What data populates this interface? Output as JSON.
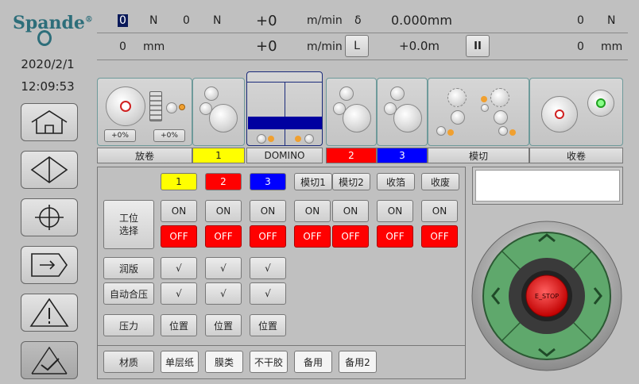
{
  "logo": {
    "text": "Spande",
    "mark": "®"
  },
  "date": "2020/2/1",
  "time": "12:09:53",
  "status": {
    "row1": {
      "v1": "0",
      "n1": "N",
      "v2": "0",
      "n2": "N",
      "plus1": "+0",
      "unit1": "m/min",
      "delta_symbol": "δ",
      "delta_value": "0.000mm",
      "v3": "0",
      "n3": "N"
    },
    "row2": {
      "v1": "0",
      "u1": "mm",
      "plus2": "+0",
      "unit2": "m/min",
      "l_button": "L",
      "offset": "+0.0m",
      "pause_button": "II",
      "v3": "0",
      "u3": "mm"
    }
  },
  "stations": {
    "unwind_pct_a": "+0%",
    "unwind_pct_b": "+0%",
    "labels": [
      "放卷",
      "1",
      "DOMINO",
      "2",
      "3",
      "模切",
      "收卷"
    ]
  },
  "control": {
    "columns": [
      "1",
      "2",
      "3",
      "模切1",
      "模切2",
      "收箔",
      "收废"
    ],
    "row_station_label": "工位\n选择",
    "on_label": "ON",
    "off_label": "OFF",
    "row_run_label": "润版",
    "row_auto_label": "自动合压",
    "check": "√",
    "row_pressure_label": "压力",
    "position_label": "位置",
    "row_material_label": "材质",
    "materials": [
      "单层纸",
      "膜类",
      "不干胶",
      "备用",
      "备用2"
    ]
  },
  "estop": {
    "label": "E_STOP"
  },
  "colors": {
    "yellow": "#ffff00",
    "red": "#ff0000",
    "blue": "#0000ff",
    "green": "#5fa86c"
  },
  "icons": [
    "home-icon",
    "diamond-icon",
    "crosshair-icon",
    "arrow-right-icon",
    "warning-icon",
    "checkmark-chart-icon"
  ]
}
